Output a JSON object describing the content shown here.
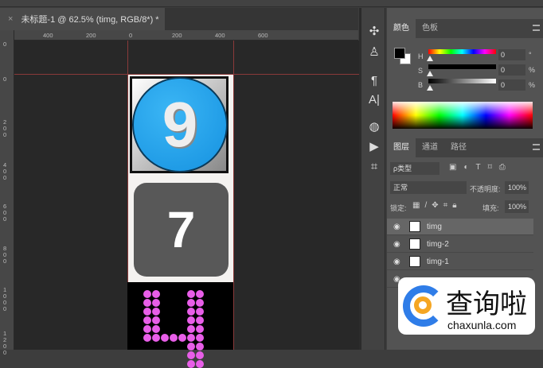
{
  "document": {
    "tab_title": "未标题-1 @ 62.5% (timg, RGB/8*) *",
    "close": "×"
  },
  "rulers": {
    "horizontal": [
      "400",
      "200",
      "0",
      "200",
      "400",
      "600"
    ],
    "vertical": [
      "0",
      "0",
      "200",
      "400",
      "600",
      "800",
      "1000",
      "1200"
    ]
  },
  "canvas_images": [
    {
      "label": "9"
    },
    {
      "label": "7"
    },
    {
      "label": "4"
    }
  ],
  "color_panel": {
    "tabs": [
      "颜色",
      "色板"
    ],
    "sliders": [
      {
        "label": "H",
        "value": "0",
        "unit": "°"
      },
      {
        "label": "S",
        "value": "0",
        "unit": "%"
      },
      {
        "label": "B",
        "value": "0",
        "unit": "%"
      }
    ],
    "foreground": "#000000",
    "background": "#ffffff"
  },
  "layers_panel": {
    "tabs": [
      "图层",
      "通道",
      "路径"
    ],
    "filter": "ρ类型",
    "blend_mode": "正常",
    "opacity_label": "不透明度:",
    "opacity": "100%",
    "lock_label": "锁定:",
    "fill_label": "填充:",
    "fill": "100%",
    "layers": [
      {
        "name": "timg",
        "selected": true
      },
      {
        "name": "timg-2"
      },
      {
        "name": "timg-1"
      }
    ]
  },
  "watermark": {
    "brand": "查询啦",
    "url": "chaxunla.com"
  }
}
